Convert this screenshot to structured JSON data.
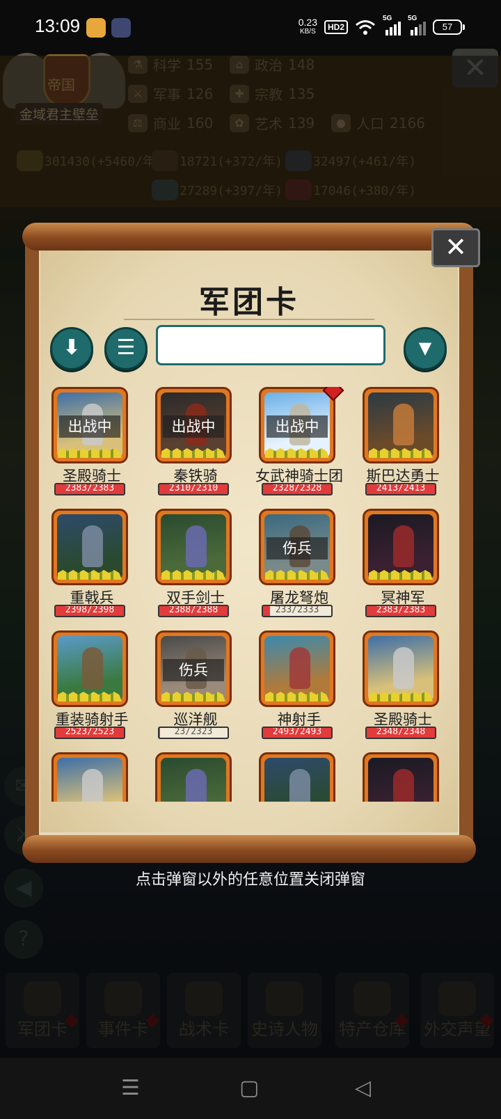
{
  "status_bar": {
    "time": "13:09",
    "net_speed_value": "0.23",
    "net_speed_unit": "KB/S",
    "hd_label": "HD2",
    "signal_label": "5G",
    "battery": "57"
  },
  "colors": {
    "accent_teal": "#1f6b6b",
    "card_orange": "#e07820",
    "hp_red": "#e23b3b"
  },
  "header": {
    "emblem_label": "帝国",
    "empire_name": "金域君主壁垒",
    "stats": [
      {
        "label": "科学",
        "value": "155",
        "icon": "flask-icon"
      },
      {
        "label": "政治",
        "value": "148",
        "icon": "temple-icon"
      },
      {
        "label": "军事",
        "value": "126",
        "icon": "crossed-swords-icon"
      },
      {
        "label": "宗教",
        "value": "135",
        "icon": "cross-icon"
      },
      {
        "label": "商业",
        "value": "160",
        "icon": "scales-icon"
      },
      {
        "label": "艺术",
        "value": "139",
        "icon": "lotus-icon"
      },
      {
        "label": "人口",
        "value": "2166",
        "icon": "person-icon"
      }
    ],
    "resources": [
      {
        "value": "301430(+5460/年)",
        "icon": "gold-icon"
      },
      {
        "value": "18721(+372/年)",
        "icon": "wood-icon"
      },
      {
        "value": "32497(+461/年)",
        "icon": "iron-icon"
      },
      {
        "value": "27289(+397/年)",
        "icon": "stone-icon"
      },
      {
        "value": "17046(+380/年)",
        "icon": "meat-icon"
      }
    ]
  },
  "modal": {
    "title": "军团卡",
    "search_placeholder": "",
    "cards": [
      {
        "name": "圣殿骑士",
        "hp": "2383/2383",
        "hp_pct": 100,
        "badge": "出战中",
        "art": "knight",
        "diamond": false
      },
      {
        "name": "秦铁骑",
        "hp": "2310/2310",
        "hp_pct": 100,
        "badge": "出战中",
        "art": "rider",
        "diamond": false
      },
      {
        "name": "女武神骑士团",
        "hp": "2328/2328",
        "hp_pct": 100,
        "badge": "出战中",
        "art": "valkyrie",
        "diamond": true
      },
      {
        "name": "斯巴达勇士",
        "hp": "2413/2413",
        "hp_pct": 100,
        "badge": "",
        "art": "spartan",
        "diamond": false
      },
      {
        "name": "重戟兵",
        "hp": "2398/2398",
        "hp_pct": 100,
        "badge": "",
        "art": "halberd",
        "diamond": false
      },
      {
        "name": "双手剑士",
        "hp": "2388/2388",
        "hp_pct": 100,
        "badge": "",
        "art": "sword",
        "diamond": false
      },
      {
        "name": "屠龙弩炮",
        "hp": "233/2333",
        "hp_pct": 10,
        "badge": "伤兵",
        "art": "dragon",
        "diamond": false
      },
      {
        "name": "冥神军",
        "hp": "2383/2383",
        "hp_pct": 100,
        "badge": "",
        "art": "demon",
        "diamond": false
      },
      {
        "name": "重装骑射手",
        "hp": "2523/2523",
        "hp_pct": 100,
        "badge": "",
        "art": "archer-rider",
        "diamond": false
      },
      {
        "name": "巡洋舰",
        "hp": "23/2323",
        "hp_pct": 1,
        "badge": "伤兵",
        "art": "ship",
        "diamond": false
      },
      {
        "name": "神射手",
        "hp": "2493/2493",
        "hp_pct": 100,
        "badge": "",
        "art": "archer",
        "diamond": false
      },
      {
        "name": "圣殿骑士",
        "hp": "2348/2348",
        "hp_pct": 100,
        "badge": "",
        "art": "knight",
        "diamond": false
      },
      {
        "name": "",
        "hp": "",
        "hp_pct": 100,
        "badge": "",
        "art": "knight",
        "diamond": false
      },
      {
        "name": "",
        "hp": "",
        "hp_pct": 100,
        "badge": "",
        "art": "sword",
        "diamond": false
      },
      {
        "name": "",
        "hp": "",
        "hp_pct": 100,
        "badge": "",
        "art": "halberd",
        "diamond": false
      },
      {
        "name": "",
        "hp": "",
        "hp_pct": 100,
        "badge": "",
        "art": "demon",
        "diamond": false
      }
    ]
  },
  "hint": "点击弹窗以外的任意位置关闭弹窗",
  "bottom_nav": [
    {
      "label": "军团卡",
      "icon": "helmet-icon"
    },
    {
      "label": "事件卡",
      "icon": "scroll-icon"
    },
    {
      "label": "战术卡",
      "icon": "shield-swords-icon"
    },
    {
      "label": "史诗人物",
      "icon": "crown-icon"
    },
    {
      "label": "特产仓库",
      "icon": "chest-icon"
    },
    {
      "label": "外交声望",
      "icon": "letter-icon"
    }
  ]
}
